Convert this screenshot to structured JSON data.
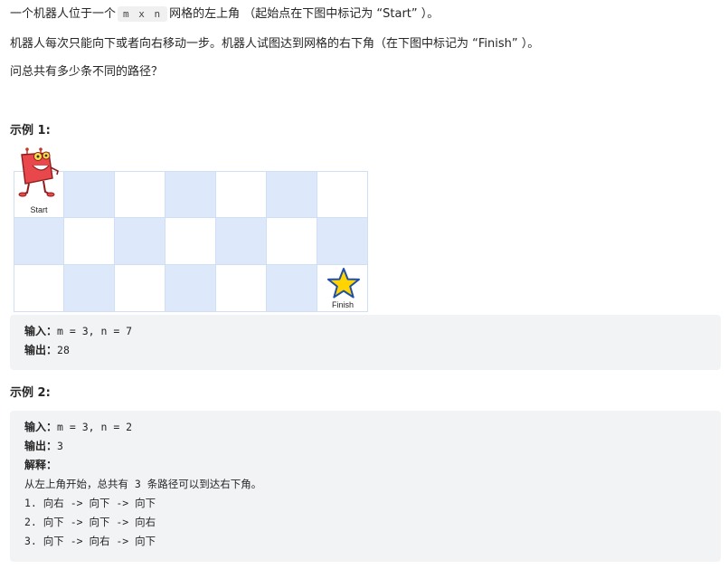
{
  "intro": {
    "line1_before": "一个机器人位于一个",
    "line1_code": "m x n",
    "line1_after": "网格的左上角 （起始点在下图中标记为 “Start” ）。",
    "line2": "机器人每次只能向下或者向右移动一步。机器人试图达到网格的右下角（在下图中标记为 “Finish” ）。",
    "line3": "问总共有多少条不同的路径？"
  },
  "example1": {
    "heading": "示例 1:",
    "grid_rows": 3,
    "grid_cols": 7,
    "start_label": "Start",
    "finish_label": "Finish",
    "input_label": "输入：",
    "input_value": "m = 3, n = 7",
    "output_label": "输出：",
    "output_value": "28"
  },
  "example2": {
    "heading": "示例 2:",
    "input_label": "输入：",
    "input_value": "m = 3, n = 2",
    "output_label": "输出：",
    "output_value": "3",
    "explain_label": "解释：",
    "explain_text": "从左上角开始，总共有 3 条路径可以到达右下角。",
    "paths": [
      "1. 向右 -> 向下 -> 向下",
      "2. 向下 -> 向下 -> 向右",
      "3. 向下 -> 向右 -> 向下"
    ]
  },
  "colors": {
    "grid_blue": "#dde9fb",
    "grid_line": "#cfe0f5",
    "code_bg": "#f2f3f5",
    "robot_red": "#e8474b",
    "star_yellow": "#ffd400"
  },
  "icons": {
    "start": "robot-icon",
    "finish": "star-icon"
  }
}
